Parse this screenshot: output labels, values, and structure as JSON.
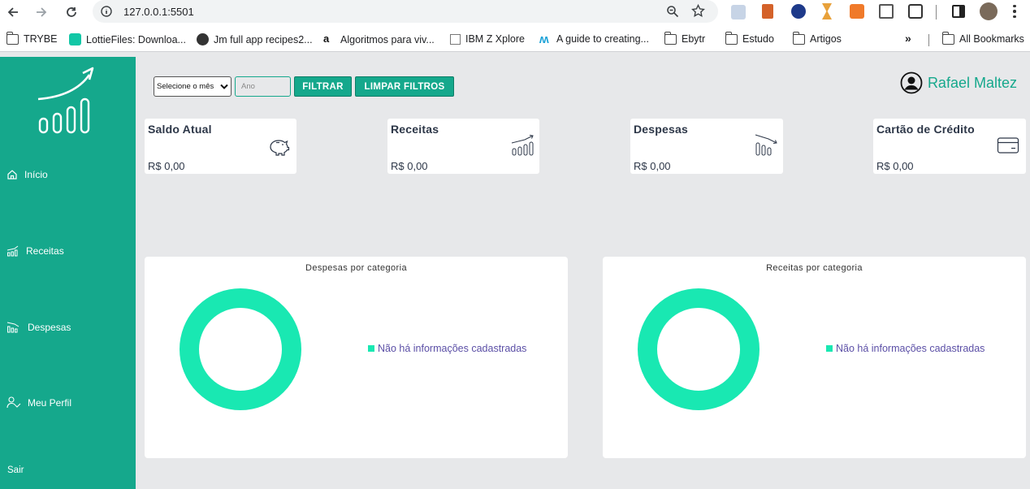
{
  "browser": {
    "url": "127.0.0.1:5501",
    "bookmarks": [
      "TRYBE",
      "LottieFiles: Downloa...",
      "Jm full app recipes2...",
      "Algoritmos para viv...",
      "IBM Z Xplore",
      "A guide to creating...",
      "Ebytr",
      "Estudo",
      "Artigos"
    ],
    "more": "»",
    "all_bookmarks": "All Bookmarks"
  },
  "sidebar": {
    "items": [
      {
        "label": "Início",
        "icon": "home-icon"
      },
      {
        "label": "Receitas",
        "icon": "chart-up-icon"
      },
      {
        "label": "Despesas",
        "icon": "chart-down-icon"
      },
      {
        "label": "Meu Perfil",
        "icon": "user-check-icon"
      }
    ],
    "logout": "Sair"
  },
  "filters": {
    "month_select": "Selecione o mês",
    "year_placeholder": "Ano",
    "filter_button": "FILTRAR",
    "clear_button": "LIMPAR FILTROS"
  },
  "user": {
    "name": "Rafael Maltez"
  },
  "cards": [
    {
      "title": "Saldo Atual",
      "value": "R$ 0,00",
      "icon": "piggy-bank-icon"
    },
    {
      "title": "Receitas",
      "value": "R$ 0,00",
      "icon": "chart-up-icon"
    },
    {
      "title": "Despesas",
      "value": "R$ 0,00",
      "icon": "chart-down-icon"
    },
    {
      "title": "Cartão de Crédito",
      "value": "R$ 0,00",
      "icon": "credit-card-icon"
    }
  ],
  "charts": {
    "expenses": {
      "title": "Despesas por categoria",
      "legend": "Não há informações cadastradas"
    },
    "income": {
      "title": "Receitas por categoria",
      "legend": "Não há informações cadastradas"
    }
  },
  "colors": {
    "primary": "#15a88c",
    "donut": "#19e8b2",
    "legend_text": "#5b4fa6",
    "background": "#e7e8ea"
  }
}
